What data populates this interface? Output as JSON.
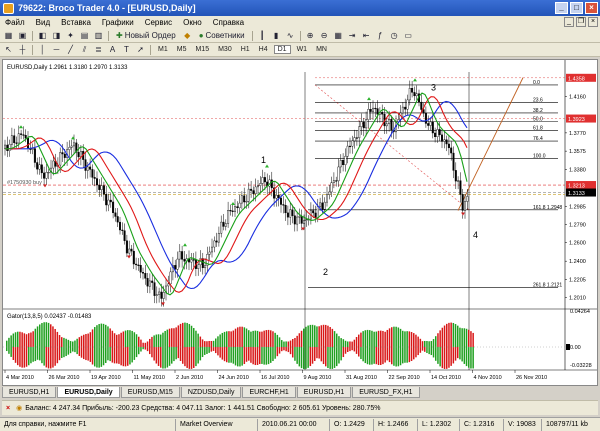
{
  "window": {
    "title": "79622: Broco Trader 4.0 - [EURUSD,Daily]"
  },
  "menu": [
    "Файл",
    "Вид",
    "Вставка",
    "Графики",
    "Сервис",
    "Окно",
    "Справка"
  ],
  "toolbar": {
    "new_order": "Новый Ордер",
    "advisors": "Советники",
    "timeframes": [
      "M1",
      "M5",
      "M15",
      "M30",
      "H1",
      "H4",
      "D1",
      "W1",
      "MN"
    ]
  },
  "chart": {
    "header": "EURUSD,Daily  1.2961 1.3180 1.2970 1.3133",
    "price_labels": [
      {
        "price": 1.4358,
        "text": "1.4358",
        "color": "#e03030"
      },
      {
        "price": 1.416,
        "text": "1.4160"
      },
      {
        "price": 1.3923,
        "text": "1.3923",
        "color": "#e03030"
      },
      {
        "price": 1.377,
        "text": "1.3770"
      },
      {
        "price": 1.3575,
        "text": "1.3575"
      },
      {
        "price": 1.338,
        "text": "1.3380"
      },
      {
        "price": 1.3213,
        "text": "1.3213",
        "color": "#e03030"
      },
      {
        "price": 1.3133,
        "text": "1.3133",
        "color": "#000000"
      },
      {
        "price": 1.2985,
        "text": "1.2985"
      },
      {
        "price": 1.279,
        "text": "1.2790"
      },
      {
        "price": 1.26,
        "text": "1.2600"
      },
      {
        "price": 1.24,
        "text": "1.2400"
      },
      {
        "price": 1.2205,
        "text": "1.2205"
      },
      {
        "price": 1.201,
        "text": "1.2010"
      }
    ],
    "fib_levels": [
      {
        "label": "0.0",
        "price": 1.4282
      },
      {
        "label": "23.6",
        "price": 1.4096
      },
      {
        "label": "38.2",
        "price": 1.3983
      },
      {
        "label": "50.0",
        "price": 1.389
      },
      {
        "label": "61.8",
        "price": 1.3797
      },
      {
        "label": "76.4",
        "price": 1.3683
      },
      {
        "label": "100.0",
        "price": 1.3497
      },
      {
        "label": "161.8  1.2948",
        "price": 1.2948
      },
      {
        "label": "261.8  1.2121",
        "price": 1.2121
      }
    ],
    "waves": [
      {
        "label": "1",
        "price": 1.345
      },
      {
        "label": "2",
        "price": 1.225
      },
      {
        "label": "3",
        "price": 1.422
      },
      {
        "label": "4",
        "price": 1.265
      }
    ],
    "side_label": "#1750930 buy",
    "indicator": {
      "header": "Gator(13,8,5) 0.02437 -0.01483",
      "labels": [
        "0.04264",
        "0.00",
        "-0.03228"
      ]
    },
    "dates": [
      "4 Mar 2010",
      "26 Mar 2010",
      "19 Apr 2010",
      "11 May 2010",
      "2 Jun 2010",
      "24 Jun 2010",
      "16 Jul 2010",
      "9 Aug 2010",
      "31 Aug 2010",
      "22 Sep 2010",
      "14 Oct 2010",
      "4 Nov 2010",
      "26 Nov 2010"
    ]
  },
  "tabs": [
    "EURUSD,H1",
    "EURUSD,Daily",
    "EURUSD,M15",
    "NZDUSD,Daily",
    "EURCHF,H1",
    "EURUSD,H1",
    "EURUSD_FX,H1"
  ],
  "account": "Баланс: 4 247.34  Прибыль: -200.23  Средства: 4 047.11  Залог: 1 441.51  Свободно: 2 605.61  Уровень: 280.75%",
  "status": [
    "Для справки, нажмите F1",
    "Market Overview",
    "2010.06.21 00:00",
    "O: 1.2429",
    "H: 1.2466",
    "L: 1.2302",
    "C: 1.2316",
    "V: 19083",
    "108797/11 kb"
  ]
}
